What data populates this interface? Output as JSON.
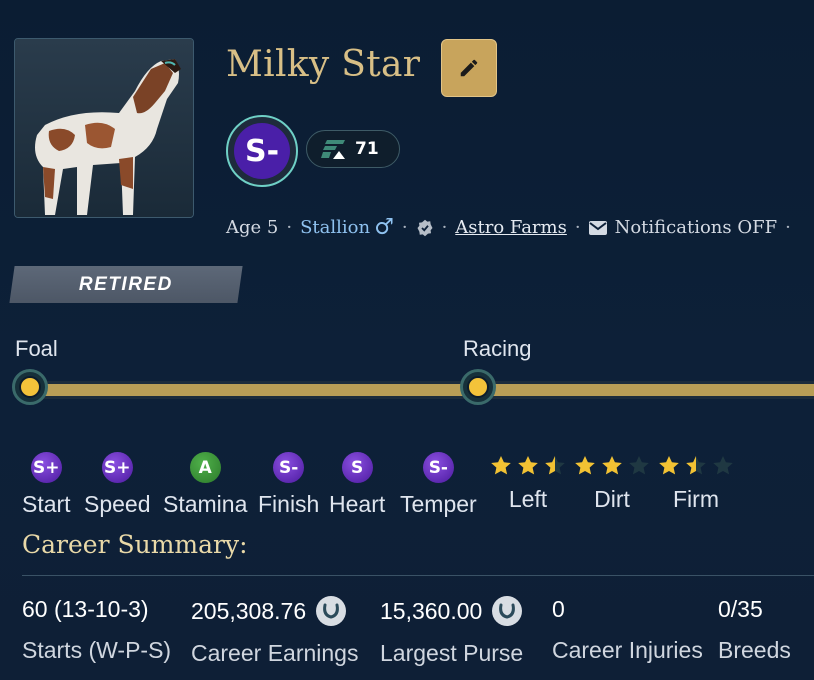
{
  "horse": {
    "name": "Milky Star",
    "grade": "S-",
    "rating": "71",
    "age": "Age 5",
    "gender": "Stallion",
    "gender_symbol": "♂",
    "farm": "Astro Farms",
    "notifications": "Notifications OFF",
    "status": "RETIRED"
  },
  "timeline": {
    "stages": [
      "Foal",
      "Racing"
    ]
  },
  "attributes": [
    {
      "grade": "S+",
      "label": "Start"
    },
    {
      "grade": "S+",
      "label": "Speed"
    },
    {
      "grade": "A",
      "label": "Stamina"
    },
    {
      "grade": "S-",
      "label": "Finish"
    },
    {
      "grade": "S",
      "label": "Heart"
    },
    {
      "grade": "S-",
      "label": "Temper"
    }
  ],
  "surfaces": [
    {
      "label": "Left",
      "stars": 2.5
    },
    {
      "label": "Dirt",
      "stars": 2
    },
    {
      "label": "Firm",
      "stars": 1.5
    }
  ],
  "career_summary": {
    "title": "Career Summary:",
    "stats": [
      {
        "value": "60 (13-10-3)",
        "label": "Starts (W-P-S)",
        "coin": false
      },
      {
        "value": "205,308.76",
        "label": "Career Earnings",
        "coin": true
      },
      {
        "value": "15,360.00",
        "label": "Largest Purse",
        "coin": true
      },
      {
        "value": "0",
        "label": "Career Injuries",
        "coin": false
      },
      {
        "value": "0/35",
        "label": "Breeds",
        "coin": false
      }
    ]
  },
  "colors": {
    "accent_gold": "#c8a45c",
    "grade_purple": "#4a1fa8",
    "grade_green": "#2c7a2b",
    "link_blue": "#8fc2f0",
    "star_gold": "#f2c233"
  }
}
